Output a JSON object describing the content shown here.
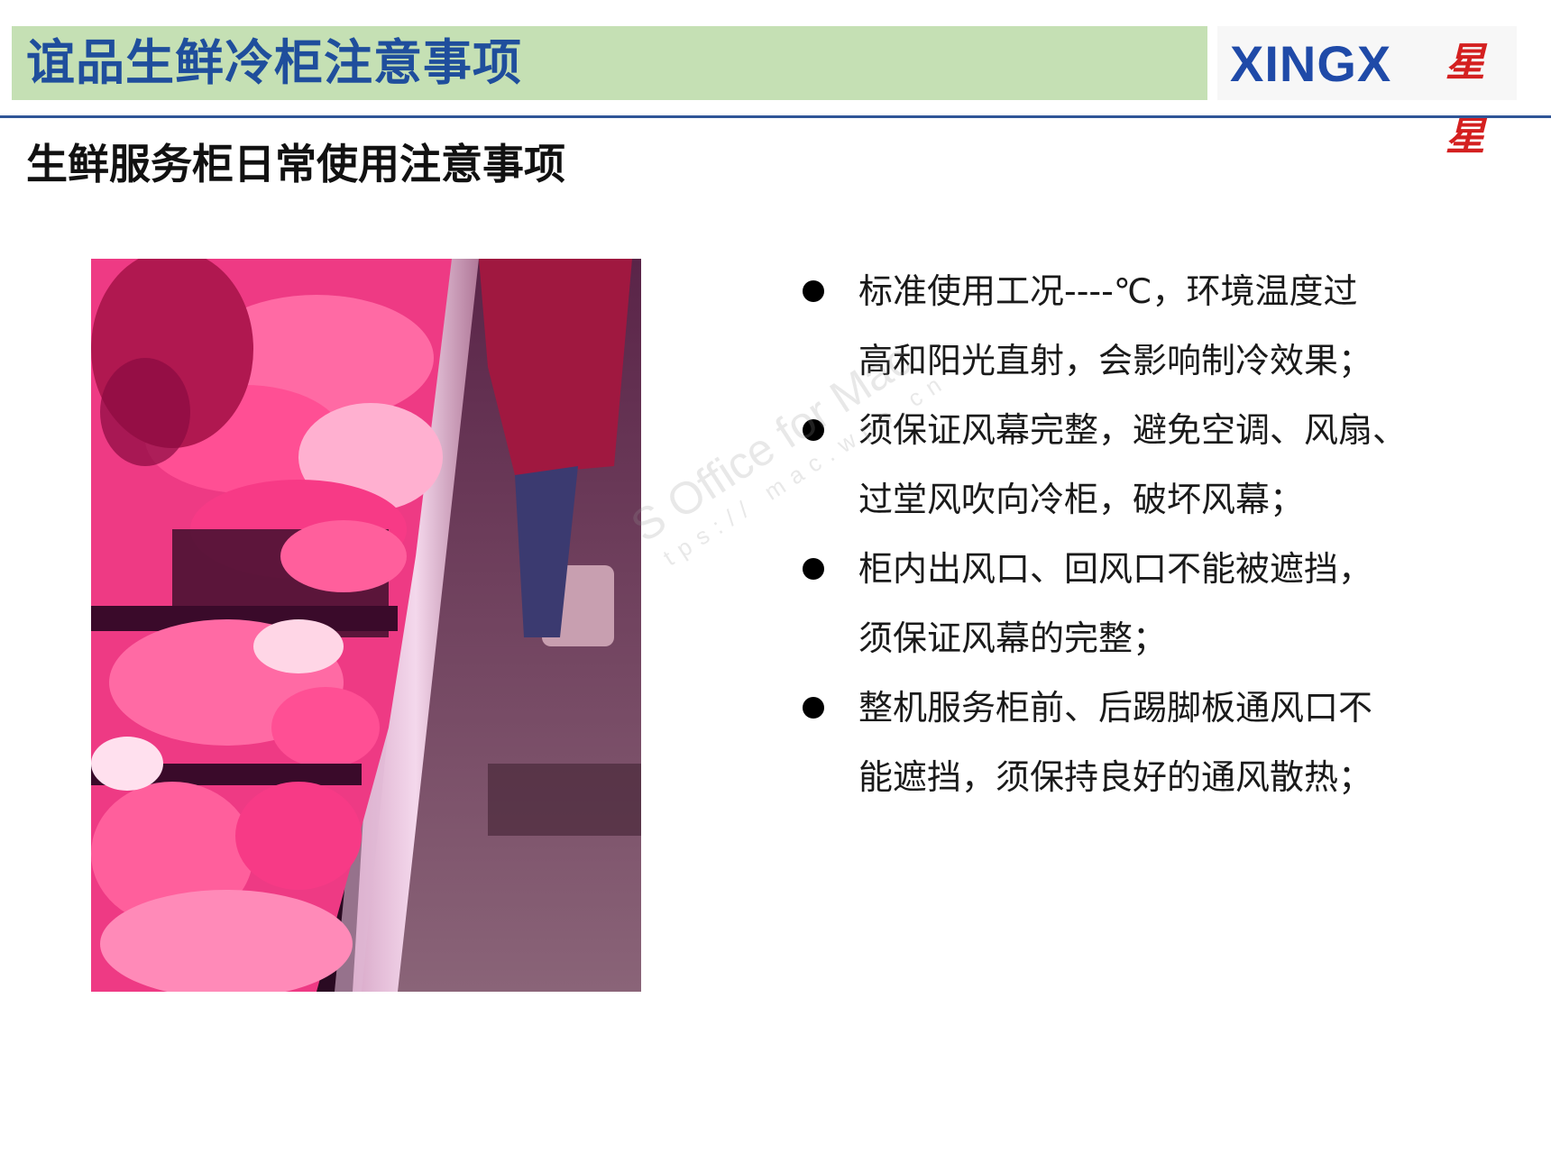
{
  "header": {
    "title": "谊品生鲜冷柜注意事项",
    "logo_text": "XINGX",
    "logo_cn": "星星"
  },
  "subtitle": "生鲜服务柜日常使用注意事项",
  "photo": {
    "icon": "photo-image"
  },
  "bullets": [
    {
      "line1": "标准使用工况----℃，环境温度过",
      "line2": "高和阳光直射，会影响制冷效果；"
    },
    {
      "line1": "须保证风幕完整，避免空调、风扇、",
      "line2": "过堂风吹向冷柜，破坏风幕；"
    },
    {
      "line1": "柜内出风口、回风口不能被遮挡，",
      "line2": "须保证风幕的完整；"
    },
    {
      "line1": "整机服务柜前、后踢脚板通风口不",
      "line2": "能遮挡，须保持良好的通风散热；"
    }
  ],
  "watermark": {
    "main": "S Office for Mac",
    "sub": "tps:// mac.wps.cn"
  },
  "colors": {
    "title_bar": "#c5e0b4",
    "title_text": "#1f4e9c",
    "rule": "#2f5597",
    "logo_blue": "#1f4aa8",
    "logo_red": "#d42020"
  }
}
